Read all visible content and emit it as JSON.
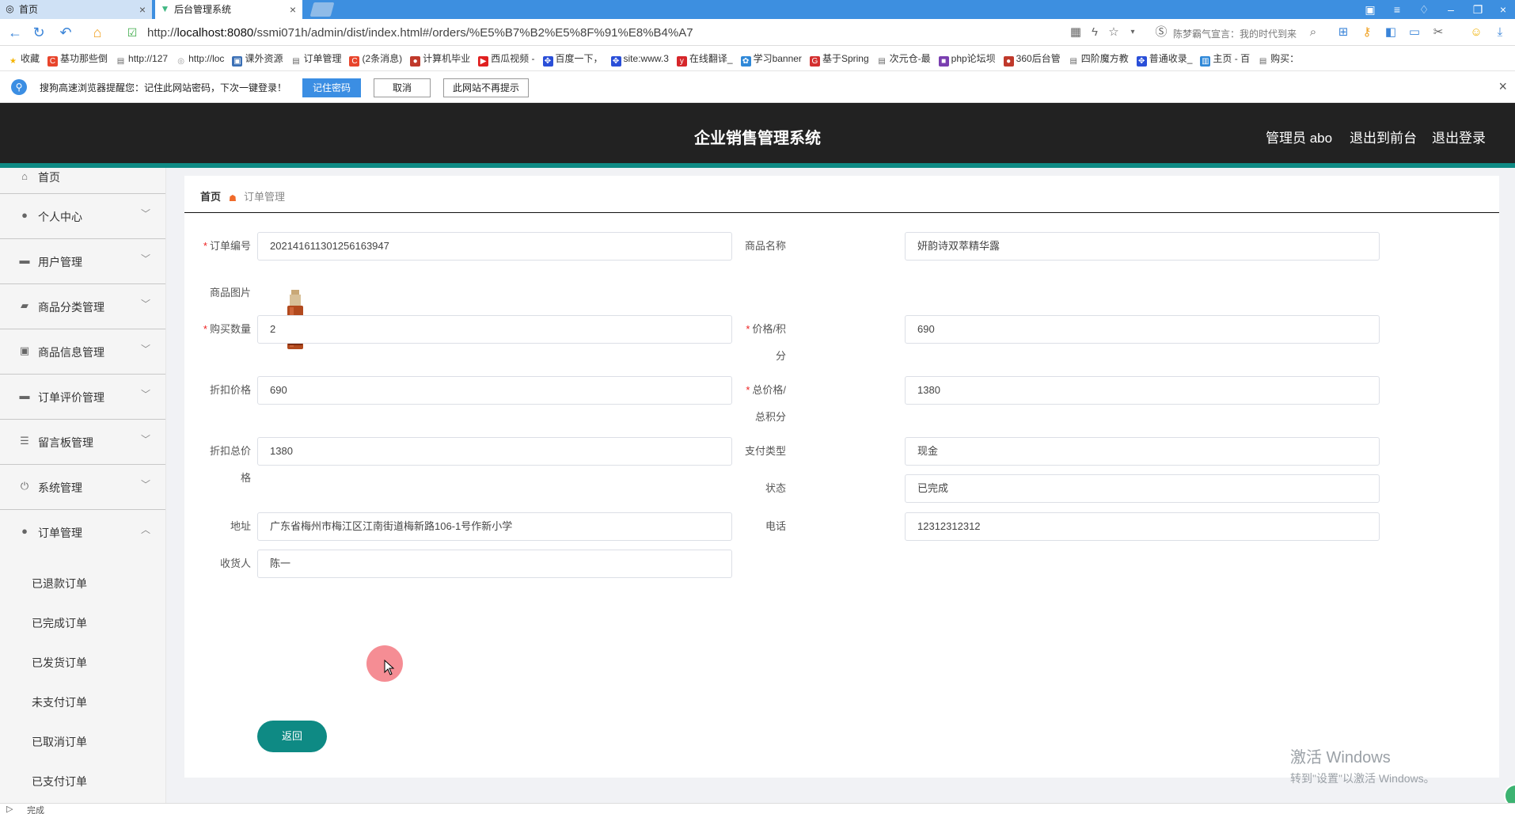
{
  "browser": {
    "tabs": [
      {
        "label": "首页",
        "active": false
      },
      {
        "label": "后台管理系统",
        "active": true
      }
    ],
    "url_prefix": "http://",
    "url_host": "localhost:8080",
    "url_path": "/ssmi071h/admin/dist/index.html#/orders/%E5%B7%B2%E5%8F%91%E8%B4%A7",
    "ad_text": "陈梦霸气宣言：我的时代到来",
    "bookmarks": [
      {
        "label": "收藏",
        "icon": "star",
        "color": "#f5b400"
      },
      {
        "label": "基功那些倒",
        "icon": "C",
        "color": "#e8452c"
      },
      {
        "label": "http://127",
        "icon": "doc",
        "color": "#666666"
      },
      {
        "label": "http://loc",
        "icon": "globe",
        "color": "#999999"
      },
      {
        "label": "课外资源",
        "icon": "img",
        "color": "#3a6fb5"
      },
      {
        "label": "订单管理",
        "icon": "doc",
        "color": "#666666"
      },
      {
        "label": "(2条消息)",
        "icon": "C",
        "color": "#e8452c"
      },
      {
        "label": "计算机毕业",
        "icon": "circle",
        "color": "#c0392b"
      },
      {
        "label": "西瓜视频 -",
        "icon": "play",
        "color": "#e02020"
      },
      {
        "label": "百度一下，",
        "icon": "paw",
        "color": "#2a4fd8"
      },
      {
        "label": "site:www.3",
        "icon": "paw",
        "color": "#2a4fd8"
      },
      {
        "label": "在线翻译_",
        "icon": "y",
        "color": "#d6262a"
      },
      {
        "label": "学习banner",
        "icon": "gear",
        "color": "#2f88d8"
      },
      {
        "label": "基于Spring",
        "icon": "G",
        "color": "#d32f2f"
      },
      {
        "label": "次元仓-最",
        "icon": "doc",
        "color": "#666666"
      },
      {
        "label": "php论坛坝",
        "icon": "sq",
        "color": "#7a3fb0"
      },
      {
        "label": "360后台管",
        "icon": "circle",
        "color": "#c0392b"
      },
      {
        "label": "四阶魔方教",
        "icon": "doc",
        "color": "#666666"
      },
      {
        "label": "普通收录_",
        "icon": "paw",
        "color": "#2a4fd8"
      },
      {
        "label": "主页 - 百",
        "icon": "chart",
        "color": "#2f88d8"
      },
      {
        "label": "购买：",
        "icon": "doc",
        "color": "#666666"
      }
    ],
    "notification": {
      "text": "搜狗高速浏览器提醒您：记住此网站密码，下次一键登录！",
      "remember": "记住密码",
      "cancel": "取消",
      "never": "此网站不再提示"
    },
    "status": "完成"
  },
  "header": {
    "title": "企业销售管理系统",
    "admin": "管理员 abo",
    "to_front": "退出到前台",
    "logout": "退出登录"
  },
  "sidebar": {
    "home": "首页",
    "items": [
      {
        "label": "个人中心",
        "icon": "user-icon"
      },
      {
        "label": "用户管理",
        "icon": "monitor-icon"
      },
      {
        "label": "商品分类管理",
        "icon": "briefcase-icon"
      },
      {
        "label": "商品信息管理",
        "icon": "clipboard-icon"
      },
      {
        "label": "订单评价管理",
        "icon": "monitor-icon"
      },
      {
        "label": "留言板管理",
        "icon": "sliders-icon"
      },
      {
        "label": "系统管理",
        "icon": "power-icon"
      },
      {
        "label": "订单管理",
        "icon": "user-icon"
      }
    ],
    "order_sub": [
      "已退款订单",
      "已完成订单",
      "已发货订单",
      "未支付订单",
      "已取消订单",
      "已支付订单"
    ]
  },
  "breadcrumb": {
    "home": "首页",
    "current": "订单管理"
  },
  "form": {
    "order_no_label": "订单编号",
    "order_no": "202141611301256163947",
    "product_name_label": "商品名称",
    "product_name": "妍韵诗双萃精华露",
    "product_image_label": "商品图片",
    "qty_label": "购买数量",
    "qty": "2",
    "price_label_1": "价格/积",
    "price_label_2": "分",
    "price": "690",
    "discount_price_label": "折扣价格",
    "discount_price": "690",
    "total_label_1": "总价格/",
    "total_label_2": "总积分",
    "total": "1380",
    "discount_total_label_1": "折扣总价",
    "discount_total_label_2": "格",
    "discount_total": "1380",
    "pay_type_label": "支付类型",
    "pay_type": "现金",
    "status_label": "状态",
    "status": "已完成",
    "address_label": "地址",
    "address": "广东省梅州市梅江区江南街道梅新路106-1号作新小学",
    "phone_label": "电话",
    "phone": "12312312312",
    "receiver_label": "收货人",
    "receiver": "陈一",
    "back_button": "返回"
  },
  "watermark": {
    "line1": "激活 Windows",
    "line2": "转到\"设置\"以激活 Windows。"
  },
  "colors": {
    "accent": "#0e8a84",
    "header_bg": "#222222",
    "required": "#ee2222"
  }
}
